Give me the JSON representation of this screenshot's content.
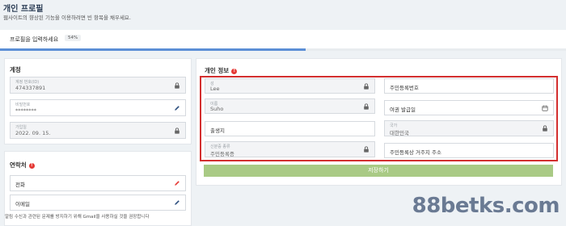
{
  "page": {
    "title": "개인 프로필",
    "subtitle": "웹사이트의 향상된 기능을 이용하려면 빈 항목을 채우세요."
  },
  "progress": {
    "label": "프로필을 입력하세요",
    "percent_label": "54%",
    "percent": 54,
    "fill_color": "#5c8fd6"
  },
  "account": {
    "title": "계정",
    "fields": [
      {
        "label": "계정 번호(ID)",
        "value": "474337891",
        "icon": "lock-icon"
      },
      {
        "label": "비밀번호",
        "value": "********",
        "icon": "pencil-icon"
      },
      {
        "label": "가입일",
        "value": "2022. 09. 15.",
        "icon": "lock-icon"
      }
    ]
  },
  "contacts": {
    "title": "연락처",
    "phone_placeholder": "전화",
    "email_placeholder": "이메일",
    "note": "알림 수신과 관련된 문제를 방지하기 위해 Gmail을 사용하실 것을 권장합니다"
  },
  "personal": {
    "title": "개인 정보",
    "last_name": {
      "label": "성",
      "value": "Lee"
    },
    "first_name": {
      "label": "이름",
      "value": "Suho"
    },
    "birthplace_placeholder": "출생지",
    "id_type": {
      "label": "신분증 종류",
      "value": "주민등록증"
    },
    "id_number_placeholder": "주민등록번호",
    "passport_date_placeholder": "여권 발급일",
    "country": {
      "label": "국가",
      "value": "대한민국"
    },
    "address_placeholder": "주민등록상 거주지 주소",
    "save_label": "저장하기"
  },
  "colors": {
    "accent_red": "#d32f2f",
    "save_button": "#a9ca85",
    "pencil_red": "#e53935",
    "pencil_blue": "#2d4f7f"
  },
  "watermark": "88betks.com"
}
